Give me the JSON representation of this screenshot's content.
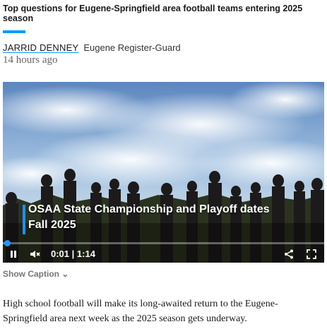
{
  "article": {
    "headline": "Top questions for Eugene-Springfield area football teams entering 2025 season",
    "author": "JARRID DENNEY",
    "outlet": "Eugene Register-Guard",
    "timestamp": "14 hours ago",
    "body": "High school football will make its long-awaited return to the Eugene-Springfield area next week as the 2025 season gets underway."
  },
  "video": {
    "overlay_line1": "OSAA State Championship and Playoff dates",
    "overlay_line2": "Fall 2025",
    "current_time": "0:01",
    "separator": "|",
    "duration": "1:14",
    "progress": 0.013,
    "muted": true,
    "paused": false
  },
  "caption": {
    "toggle_label": "Show Caption",
    "chevron_icon": "chevron-down-icon"
  },
  "colors": {
    "accent": "#009bff",
    "progress": "#2196ff"
  }
}
